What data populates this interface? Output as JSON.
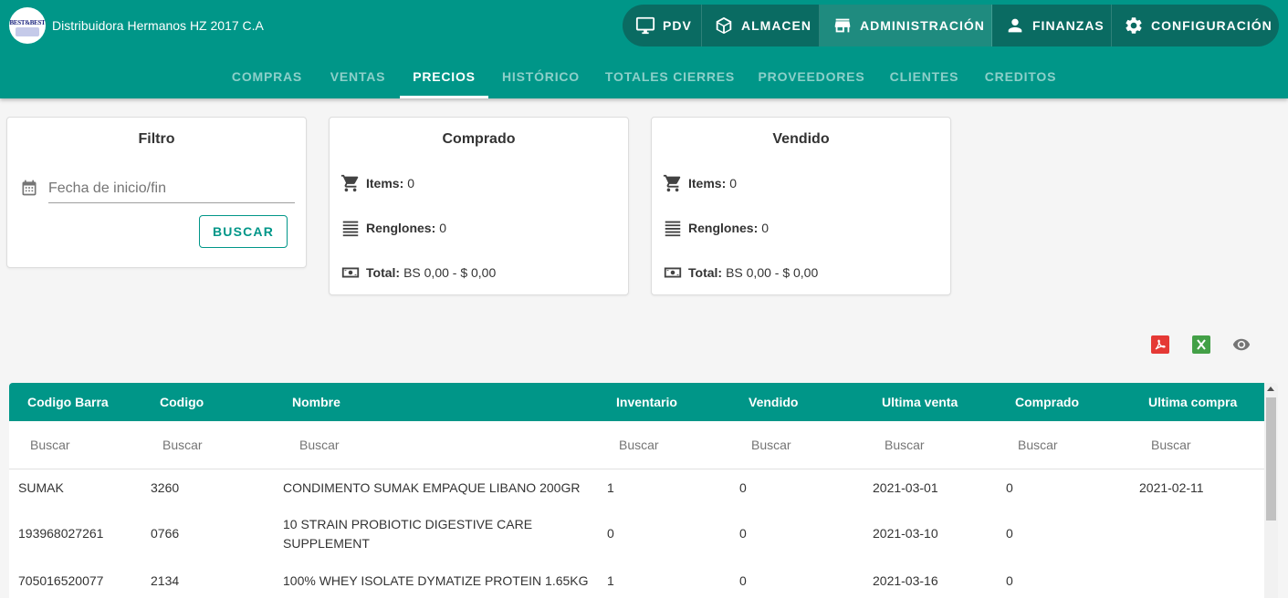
{
  "app": {
    "logo_text": "BEST&BEST",
    "company": "Distribuidora Hermanos HZ 2017 C.A"
  },
  "main_nav": [
    {
      "label": "PDV",
      "icon": "monitor-icon"
    },
    {
      "label": "ALMACEN",
      "icon": "cube-icon"
    },
    {
      "label": "ADMINISTRACIÓN",
      "icon": "store-icon",
      "active": true
    },
    {
      "label": "FINANZAS",
      "icon": "person-icon"
    },
    {
      "label": "CONFIGURACIÓN",
      "icon": "gear-icon"
    }
  ],
  "sub_nav": [
    {
      "label": "COMPRAS"
    },
    {
      "label": "VENTAS"
    },
    {
      "label": "PRECIOS",
      "active": true
    },
    {
      "label": "HISTÓRICO"
    },
    {
      "label": "TOTALES CIERRES"
    },
    {
      "label": "PROVEEDORES"
    },
    {
      "label": "CLIENTES"
    },
    {
      "label": "CREDITOS"
    }
  ],
  "filter_card": {
    "title": "Filtro",
    "date_placeholder": "Fecha de inicio/fin",
    "search_button": "BUSCAR"
  },
  "comprado": {
    "title": "Comprado",
    "items_label": "Items:",
    "items_value": "0",
    "renglones_label": "Renglones:",
    "renglones_value": "0",
    "total_label": "Total:",
    "total_value": "BS 0,00 - $ 0,00"
  },
  "vendido": {
    "title": "Vendido",
    "items_label": "Items:",
    "items_value": "0",
    "renglones_label": "Renglones:",
    "renglones_value": "0",
    "total_label": "Total:",
    "total_value": "BS 0,00 - $ 0,00"
  },
  "export": {
    "pdf_icon": "pdf-icon",
    "excel_icon": "excel-icon",
    "view_icon": "eye-icon",
    "colors": {
      "pdf": "#e53935",
      "excel": "#43a047",
      "view": "#757575"
    }
  },
  "table": {
    "columns": [
      "Codigo Barra",
      "Codigo",
      "Nombre",
      "Inventario",
      "Vendido",
      "Ultima venta",
      "Comprado",
      "Ultima compra"
    ],
    "filter_placeholder": "Buscar",
    "rows": [
      [
        "SUMAK",
        "3260",
        "CONDIMENTO SUMAK EMPAQUE LIBANO 200GR",
        "1",
        "0",
        "2021-03-01",
        "0",
        "2021-02-11"
      ],
      [
        "193968027261",
        "0766",
        "10 STRAIN PROBIOTIC DIGESTIVE CARE SUPPLEMENT",
        "0",
        "0",
        "2021-03-10",
        "0",
        ""
      ],
      [
        "705016520077",
        "2134",
        "100% WHEY ISOLATE DYMATIZE PROTEIN 1.65KG",
        "1",
        "0",
        "2021-03-16",
        "0",
        ""
      ]
    ]
  },
  "colors": {
    "primary": "#009688",
    "nav_pill": "#0a6b62",
    "nav_active": "#1f8b7f"
  }
}
